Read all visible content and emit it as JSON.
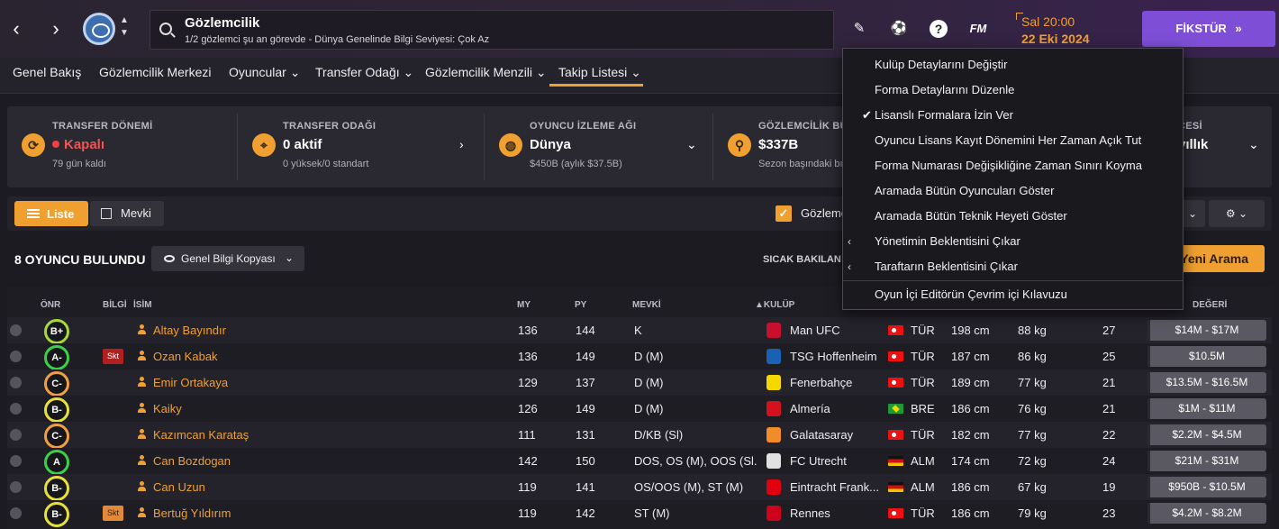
{
  "header": {
    "title": "Gözlemcilik",
    "subtitle": "1/2 gözlemci şu an görevde - Dünya Genelinde Bilgi Seviyesi: Çok Az",
    "fm_label": "FM",
    "time": "Sal 20:00",
    "date": "22 Eki 2024",
    "fikstur_label": "FİKSTÜR"
  },
  "subnav": [
    "Genel Bakış",
    "Gözlemcilik Merkezi",
    "Oyuncular",
    "Transfer Odağı",
    "Gözlemcilik Menzili",
    "Takip Listesi"
  ],
  "info_cards": [
    {
      "label": "TRANSFER DÖNEMİ",
      "value": "Kapalı",
      "sub": "79 gün kaldı"
    },
    {
      "label": "TRANSFER ODAĞI",
      "value": "0 aktif",
      "sub": "0 yüksek/0 standart"
    },
    {
      "label": "OYUNCU İZLEME AĞI",
      "value": "Dünya",
      "sub": "$450B (aylık $37.5B)"
    },
    {
      "label": "GÖZLEMCİLİK BÜT",
      "value": "$337B",
      "sub": "Sezon başındaki bı"
    },
    {
      "label": "ÇESİ",
      "value": "yıllık",
      "sub": ""
    }
  ],
  "toolbar": {
    "liste": "Liste",
    "mevki": "Mevki",
    "gozlem": "Gözleme"
  },
  "results": {
    "count_label": "8 OYUNCU BULUNDU",
    "view_select": "Genel Bilgi Kopyası",
    "sicak": "SICAK BAKILAN",
    "yeni_arama": "Yeni Arama"
  },
  "columns": {
    "onr": "ÖNR",
    "bilgi": "BİLGİ",
    "isim": "İSİM",
    "my": "MY",
    "py": "PY",
    "mevki": "MEVKİ",
    "kulup": "KULÜP",
    "degeri": "DEĞERİ"
  },
  "players": [
    {
      "grade": "B+",
      "grade_color": "#a6d93a",
      "skt": "",
      "name": "Altay Bayındır",
      "my": "136",
      "py": "144",
      "pos": "K",
      "club": "Man UFC",
      "club_color": "#c8102e",
      "nat": "TÜR",
      "flag": "tur",
      "height": "198 cm",
      "weight": "88 kg",
      "age": "27",
      "value": "$14M - $17M"
    },
    {
      "grade": "A-",
      "grade_color": "#3ad04a",
      "skt": "Skt",
      "skt_style": "red",
      "name": "Ozan Kabak",
      "my": "136",
      "py": "149",
      "pos": "D (M)",
      "club": "TSG Hoffenheim",
      "club_color": "#1961b5",
      "nat": "TÜR",
      "flag": "tur",
      "height": "187 cm",
      "weight": "86 kg",
      "age": "25",
      "value": "$10.5M"
    },
    {
      "grade": "C-",
      "grade_color": "#f0a040",
      "skt": "",
      "name": "Emir Ortakaya",
      "my": "129",
      "py": "137",
      "pos": "D (M)",
      "club": "Fenerbahçe",
      "club_color": "#f5d800",
      "nat": "TÜR",
      "flag": "tur",
      "height": "189 cm",
      "weight": "77 kg",
      "age": "21",
      "value": "$13.5M - $16.5M"
    },
    {
      "grade": "B-",
      "grade_color": "#e8e03a",
      "skt": "",
      "name": "Kaiky",
      "my": "126",
      "py": "149",
      "pos": "D (M)",
      "club": "Almería",
      "club_color": "#d4111d",
      "nat": "BRE",
      "flag": "bre",
      "height": "186 cm",
      "weight": "76 kg",
      "age": "21",
      "value": "$1M - $11M"
    },
    {
      "grade": "C-",
      "grade_color": "#f0a040",
      "skt": "",
      "name": "Kazımcan Karataş",
      "my": "111",
      "py": "131",
      "pos": "D/KB (Sl)",
      "club": "Galatasaray",
      "club_color": "#f28c28",
      "nat": "TÜR",
      "flag": "tur",
      "height": "182 cm",
      "weight": "77 kg",
      "age": "22",
      "value": "$2.2M - $4.5M"
    },
    {
      "grade": "A",
      "grade_color": "#3ad04a",
      "skt": "",
      "name": "Can Bozdogan",
      "my": "142",
      "py": "150",
      "pos": "DOS, OS (M), OOS (Sl...",
      "club": "FC Utrecht",
      "club_color": "#e0e0e0",
      "nat": "ALM",
      "flag": "alm",
      "height": "174 cm",
      "weight": "72 kg",
      "age": "24",
      "value": "$21M - $31M"
    },
    {
      "grade": "B-",
      "grade_color": "#e8e03a",
      "skt": "",
      "name": "Can Uzun",
      "my": "119",
      "py": "141",
      "pos": "OS/OOS (M), ST (M)",
      "club": "Eintracht Frank...",
      "club_color": "#e1000f",
      "nat": "ALM",
      "flag": "alm",
      "height": "186 cm",
      "weight": "67 kg",
      "age": "19",
      "value": "$950B - $10.5M"
    },
    {
      "grade": "B-",
      "grade_color": "#e8e03a",
      "skt": "Skt",
      "skt_style": "orange",
      "name": "Bertuğ Yıldırım",
      "my": "119",
      "py": "142",
      "pos": "ST (M)",
      "club": "Rennes",
      "club_color": "#d0021b",
      "nat": "TÜR",
      "flag": "tur",
      "height": "186 cm",
      "weight": "79 kg",
      "age": "23",
      "value": "$4.2M - $8.2M"
    }
  ],
  "dropdown": [
    {
      "label": "Kulüp Detaylarını Değiştir",
      "mark": ""
    },
    {
      "label": "Forma Detaylarını Düzenle",
      "mark": ""
    },
    {
      "label": "Lisanslı Formalara İzin Ver",
      "mark": "check"
    },
    {
      "label": "Oyuncu Lisans Kayıt Dönemini Her Zaman Açık Tut",
      "mark": ""
    },
    {
      "label": "Forma Numarası Değişikliğine Zaman Sınırı Koyma",
      "mark": ""
    },
    {
      "label": "Aramada Bütün Oyuncuları Göster",
      "mark": ""
    },
    {
      "label": "Aramada Bütün Teknik Heyeti Göster",
      "mark": ""
    },
    {
      "label": "Yönetimin Beklentisini Çıkar",
      "mark": "arrow"
    },
    {
      "label": "Taraftarın Beklentisini Çıkar",
      "mark": "arrow"
    },
    {
      "label": "Oyun İçi Editörün Çevrim içi Kılavuzu",
      "mark": ""
    }
  ],
  "colors": {
    "accent": "#f0a030",
    "fikstur": "#7e4fd6"
  }
}
